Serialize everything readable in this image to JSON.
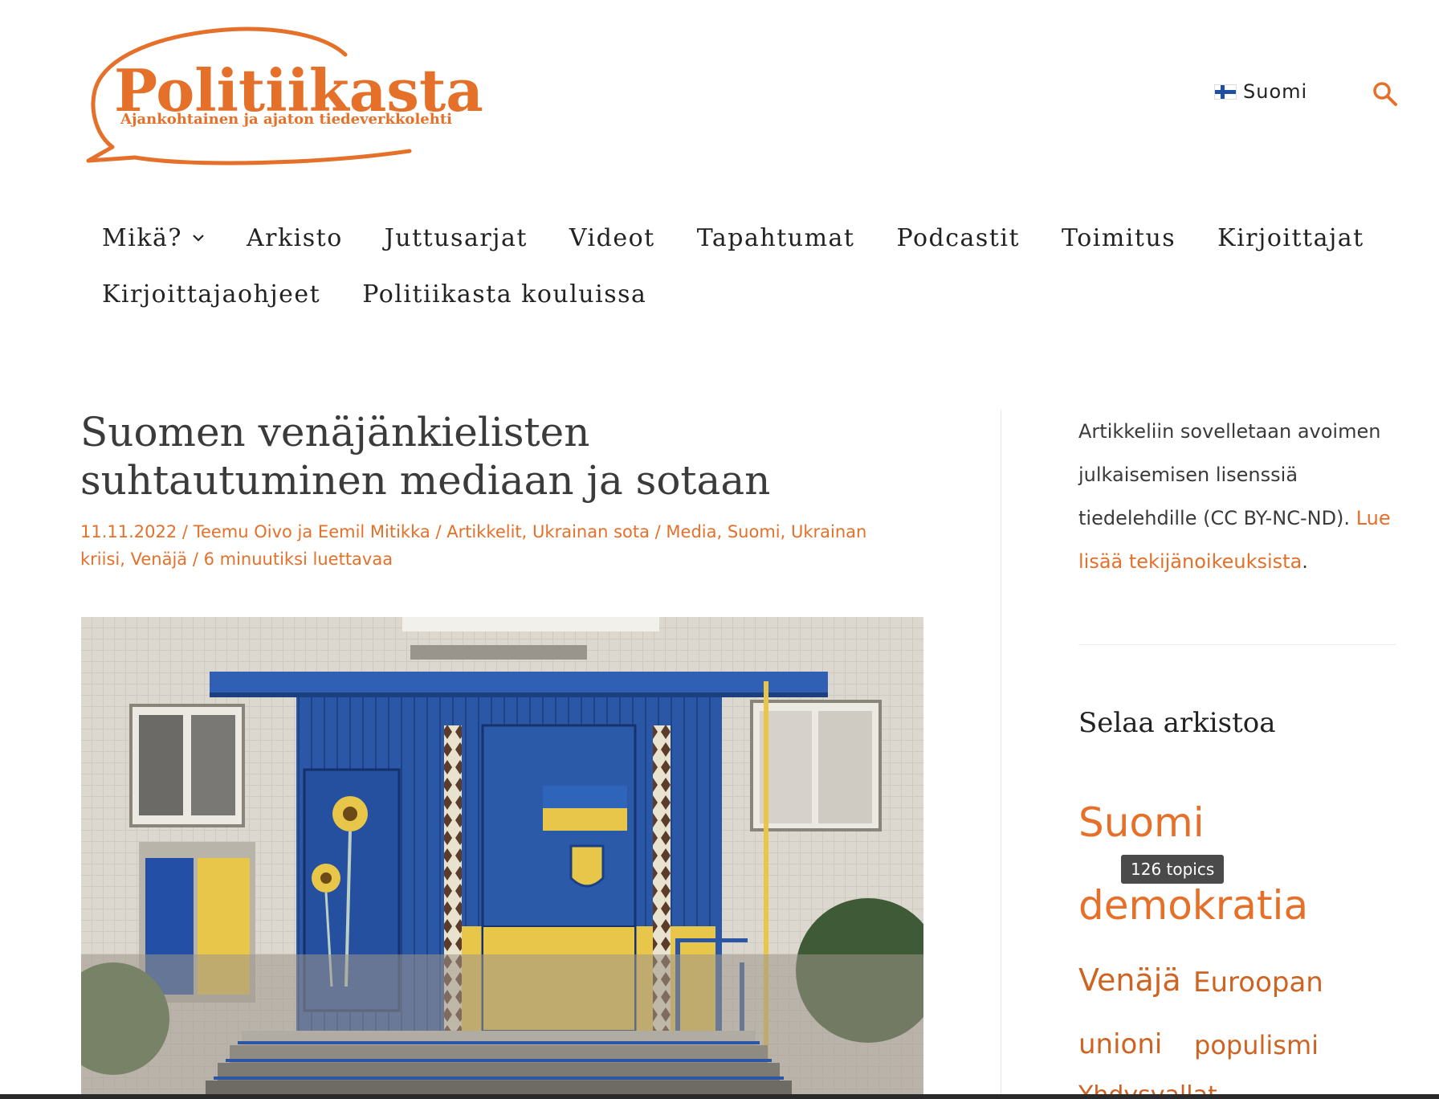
{
  "site": {
    "logo_title": "Politiikasta",
    "logo_tagline": "Ajankohtainen ja ajaton tiedeverkkolehti",
    "brand_color": "#e5702a"
  },
  "header": {
    "language_label": "Suomi",
    "language_flag_icon": "finland-flag-icon",
    "search_icon": "search-icon"
  },
  "nav": {
    "row1": [
      "Mikä?",
      "Arkisto",
      "Juttusarjat",
      "Videot",
      "Tapahtumat",
      "Podcastit",
      "Toimitus",
      "Kirjoittajat"
    ],
    "row2": [
      "Kirjoittajaohjeet",
      "Politiikasta kouluissa"
    ]
  },
  "article": {
    "title_line1": "Suomen venäjänkielisten",
    "title_line2": "suhtautuminen mediaan ja sotaan",
    "date": "11.11.2022",
    "author": "Teemu Oivo ja Eemil Mitikka",
    "categories": [
      "Artikkelit",
      "Ukrainan sota"
    ],
    "tags": [
      "Media",
      "Suomi",
      "Ukrainan kriisi",
      "Venäjä"
    ],
    "reading_time": "6 minuutiksi luettavaa",
    "separator": " / ",
    "comma": ", "
  },
  "sidebar": {
    "license_text": "Artikkeliin sovelletaan avoimen julkaisemisen lisenssiä tiedelehdille (CC BY-NC-ND).",
    "license_link": "Lue lisää tekijänoikeuksista",
    "license_link_suffix": ".",
    "archive_heading": "Selaa arkistoa",
    "tag_cloud": [
      "Suomi",
      "demokratia",
      "Venäjä",
      "Euroopan",
      "unioni",
      "populismi",
      "Yhdysvallat"
    ],
    "tooltip": "126 topics"
  }
}
